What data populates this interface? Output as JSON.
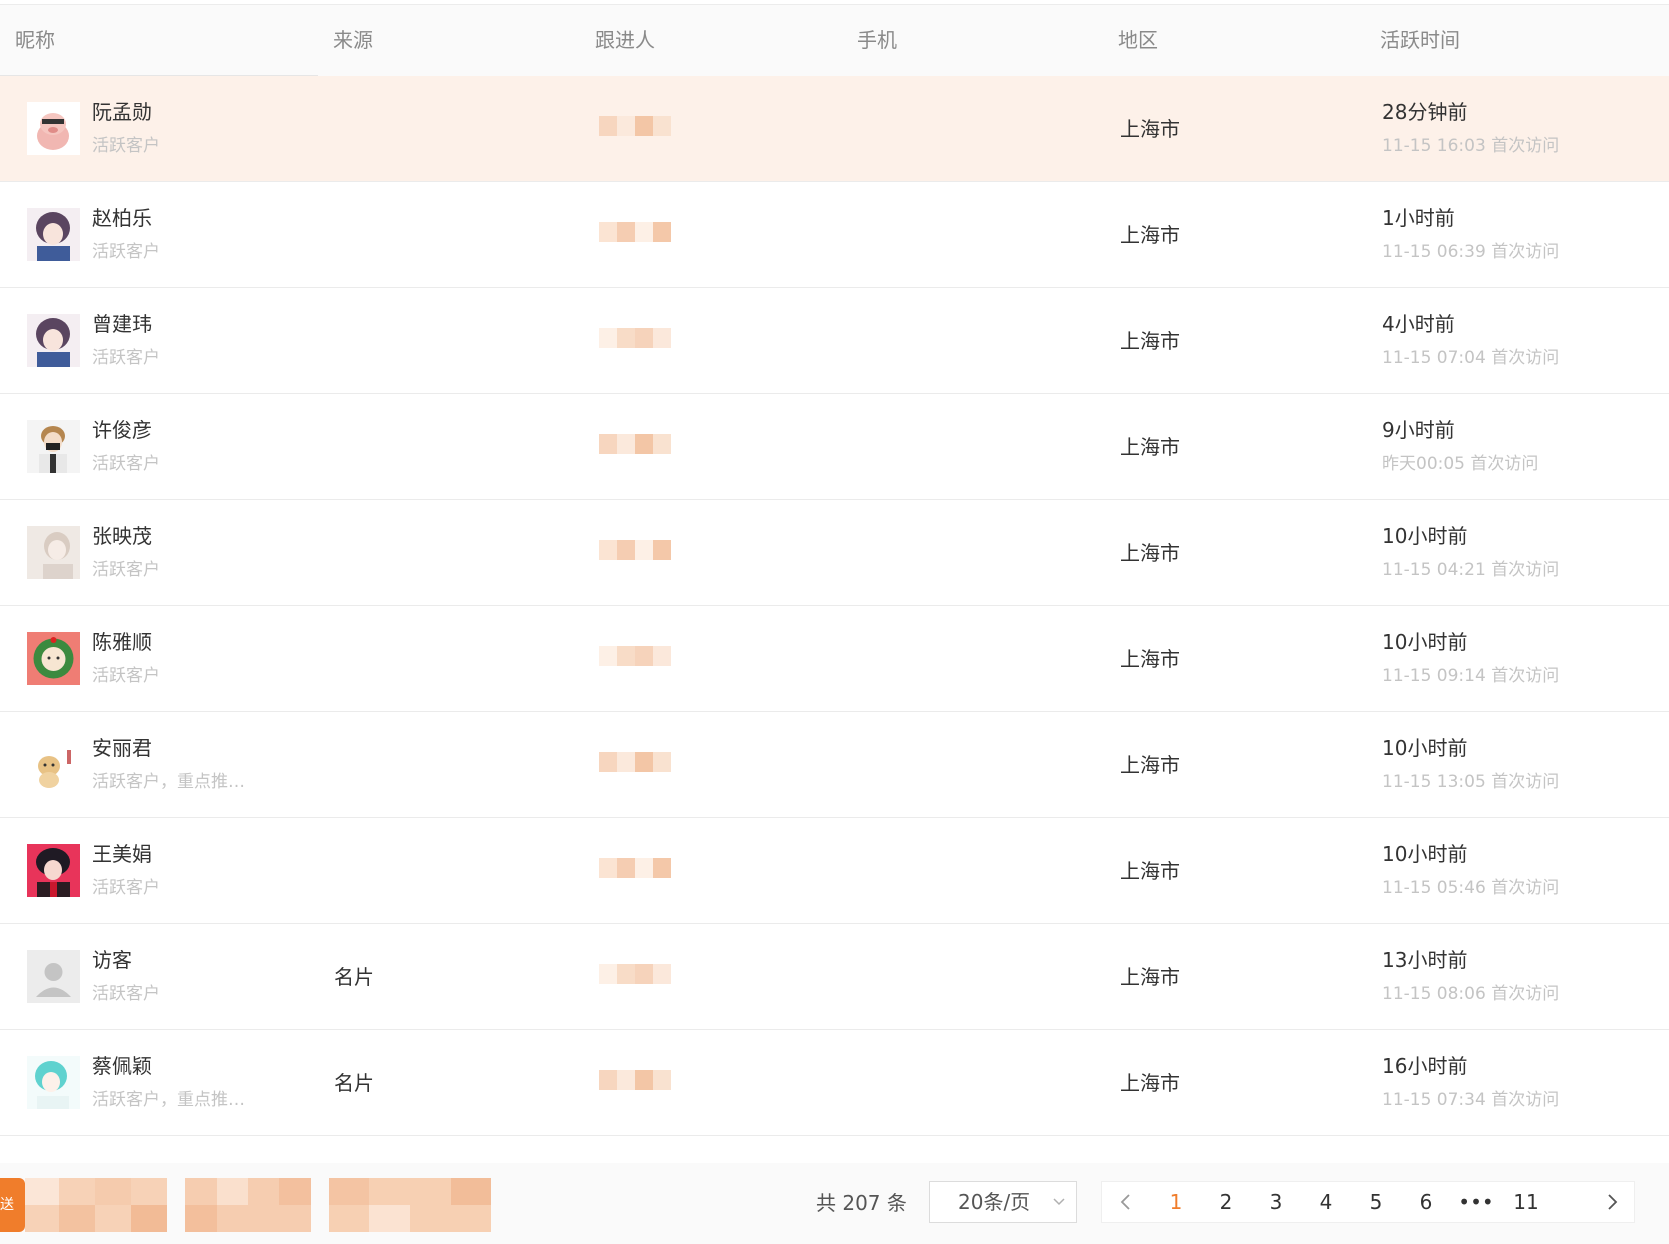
{
  "table": {
    "columns": {
      "nickname": "昵称",
      "source": "来源",
      "follower": "跟进人",
      "phone": "手机",
      "region": "地区",
      "active_time": "活跃时间"
    },
    "rows": [
      {
        "nickname": "阮孟勋",
        "tags": "活跃客户",
        "source": "",
        "phone": "",
        "region": "上海市",
        "active": "28分钟前",
        "first_visit": "11-15 16:03 首次访问",
        "avatar": "pig-avatar-icon",
        "highlighted": true
      },
      {
        "nickname": "赵柏乐",
        "tags": "活跃客户",
        "source": "",
        "phone": "",
        "region": "上海市",
        "active": "1小时前",
        "first_visit": "11-15 06:39 首次访问",
        "avatar": "anime-girl-avatar-icon",
        "highlighted": false
      },
      {
        "nickname": "曾建玮",
        "tags": "活跃客户",
        "source": "",
        "phone": "",
        "region": "上海市",
        "active": "4小时前",
        "first_visit": "11-15 07:04 首次访问",
        "avatar": "anime-girl-avatar-icon",
        "highlighted": false
      },
      {
        "nickname": "许俊彦",
        "tags": "活跃客户",
        "source": "",
        "phone": "",
        "region": "上海市",
        "active": "9小时前",
        "first_visit": "昨天00:05 首次访问",
        "avatar": "masked-boy-avatar-icon",
        "highlighted": false
      },
      {
        "nickname": "张映茂",
        "tags": "活跃客户",
        "source": "",
        "phone": "",
        "region": "上海市",
        "active": "10小时前",
        "first_visit": "11-15 04:21 首次访问",
        "avatar": "sketch-avatar-icon",
        "highlighted": false
      },
      {
        "nickname": "陈雅顺",
        "tags": "活跃客户",
        "source": "",
        "phone": "",
        "region": "上海市",
        "active": "10小时前",
        "first_visit": "11-15 09:14 首次访问",
        "avatar": "wreath-dog-avatar-icon",
        "highlighted": false
      },
      {
        "nickname": "安丽君",
        "tags": "活跃客户，重点推…",
        "source": "",
        "phone": "",
        "region": "上海市",
        "active": "10小时前",
        "first_visit": "11-15 13:05 首次访问",
        "avatar": "puppy-avatar-icon",
        "highlighted": false
      },
      {
        "nickname": "王美娟",
        "tags": "活跃客户",
        "source": "",
        "phone": "",
        "region": "上海市",
        "active": "10小时前",
        "first_visit": "11-15 05:46 首次访问",
        "avatar": "red-anime-avatar-icon",
        "highlighted": false
      },
      {
        "nickname": "访客",
        "tags": "活跃客户",
        "source": "名片",
        "phone": "",
        "region": "上海市",
        "active": "13小时前",
        "first_visit": "11-15 08:06 首次访问",
        "avatar": "default-user-avatar-icon",
        "highlighted": false
      },
      {
        "nickname": "蔡佩颖",
        "tags": "活跃客户，重点推…",
        "source": "名片",
        "phone": "",
        "region": "上海市",
        "active": "16小时前",
        "first_visit": "11-15 07:34 首次访问",
        "avatar": "cyan-anime-avatar-icon",
        "highlighted": false
      }
    ]
  },
  "footer": {
    "total": "共 207 条",
    "page_size": "20条/页",
    "pages": [
      "1",
      "2",
      "3",
      "4",
      "5",
      "6",
      "•••",
      "11"
    ],
    "current_page": "1",
    "prev_icon": "chevron-left-icon",
    "next_icon": "chevron-right-icon"
  },
  "colors": {
    "accent": "#f07d2b",
    "highlight_row": "#fdf1e9",
    "header_bg": "#fafafa",
    "muted_text": "#c4c4c4"
  }
}
